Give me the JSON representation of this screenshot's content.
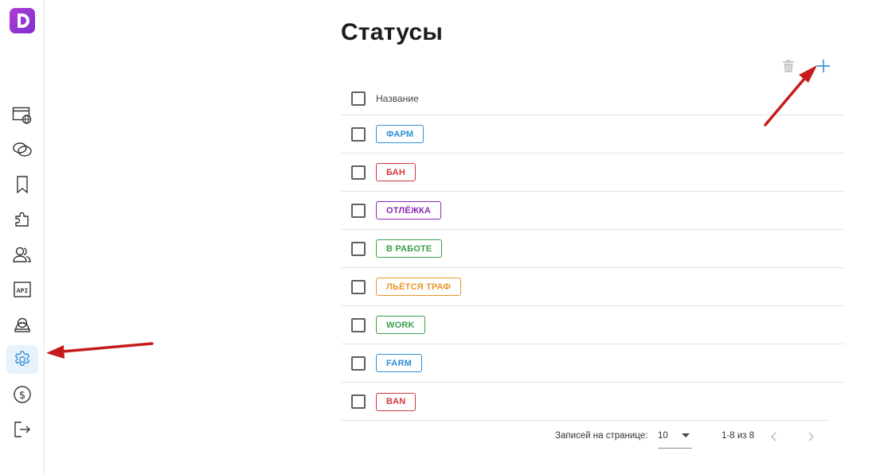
{
  "sidebar": {
    "logo_letter": "D",
    "items": [
      {
        "icon": "browser-globe-icon"
      },
      {
        "icon": "link-rings-icon"
      },
      {
        "icon": "bookmark-icon"
      },
      {
        "icon": "puzzle-icon"
      },
      {
        "icon": "users-icon"
      },
      {
        "icon": "api-icon",
        "label": "API"
      },
      {
        "icon": "robot-icon"
      },
      {
        "icon": "gear-icon",
        "active": true
      },
      {
        "icon": "dollar-coin-icon"
      },
      {
        "icon": "logout-icon"
      }
    ]
  },
  "page": {
    "title": "Статусы"
  },
  "table": {
    "column_name": "Название",
    "rows": [
      {
        "label": "ФАРМ",
        "color": "#2d8fd5"
      },
      {
        "label": "БАН",
        "color": "#d0393c"
      },
      {
        "label": "ОТЛЁЖКА",
        "color": "#8a2bb2"
      },
      {
        "label": "В РАБОТЕ",
        "color": "#3aa04a"
      },
      {
        "label": "ЛЬЁТСЯ ТРАФ",
        "color": "#e8962b"
      },
      {
        "label": "WORK",
        "color": "#3aa04a"
      },
      {
        "label": "FARM",
        "color": "#2d8fd5"
      },
      {
        "label": "BAN",
        "color": "#d0393c"
      }
    ]
  },
  "pagination": {
    "rows_per_page_label": "Записей на странице:",
    "rows_per_page_value": "10",
    "range_text": "1-8 из 8"
  },
  "colors": {
    "accent": "#2d8fd5",
    "annotation_arrow": "#c41c1c",
    "active_nav_bg": "#e8f2fb"
  }
}
